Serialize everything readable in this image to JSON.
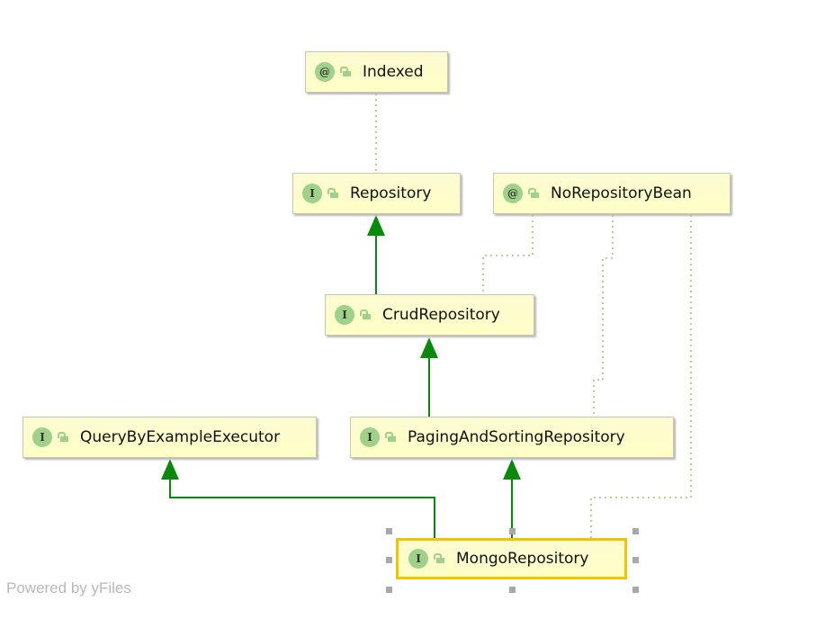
{
  "nodes": [
    {
      "id": "indexed",
      "label": "Indexed",
      "kind": "@",
      "icon": "annotation-icon"
    },
    {
      "id": "repository",
      "label": "Repository",
      "kind": "I",
      "icon": "interface-icon"
    },
    {
      "id": "norepositorybean",
      "label": "NoRepositoryBean",
      "kind": "@",
      "icon": "annotation-icon"
    },
    {
      "id": "crudrepository",
      "label": "CrudRepository",
      "kind": "I",
      "icon": "interface-icon"
    },
    {
      "id": "querybyexampleexecutor",
      "label": "QueryByExampleExecutor",
      "kind": "I",
      "icon": "interface-icon"
    },
    {
      "id": "pagingandsortingrepository",
      "label": "PagingAndSortingRepository",
      "kind": "I",
      "icon": "interface-icon"
    },
    {
      "id": "mongorepository",
      "label": "MongoRepository",
      "kind": "I",
      "icon": "interface-icon",
      "selected": true
    }
  ],
  "edges": [
    {
      "from": "repository",
      "to": "indexed",
      "type": "annotation"
    },
    {
      "from": "crudrepository",
      "to": "repository",
      "type": "extends"
    },
    {
      "from": "crudrepository",
      "to": "norepositorybean",
      "type": "annotation"
    },
    {
      "from": "pagingandsortingrepository",
      "to": "crudrepository",
      "type": "extends"
    },
    {
      "from": "pagingandsortingrepository",
      "to": "norepositorybean",
      "type": "annotation"
    },
    {
      "from": "mongorepository",
      "to": "pagingandsortingrepository",
      "type": "extends"
    },
    {
      "from": "mongorepository",
      "to": "querybyexampleexecutor",
      "type": "extends"
    },
    {
      "from": "mongorepository",
      "to": "norepositorybean",
      "type": "annotation"
    }
  ],
  "colors": {
    "extends": "#0a8a0a",
    "annotation": "#c8c890",
    "selection": "#f5c400"
  },
  "footer": "Powered by yFiles"
}
